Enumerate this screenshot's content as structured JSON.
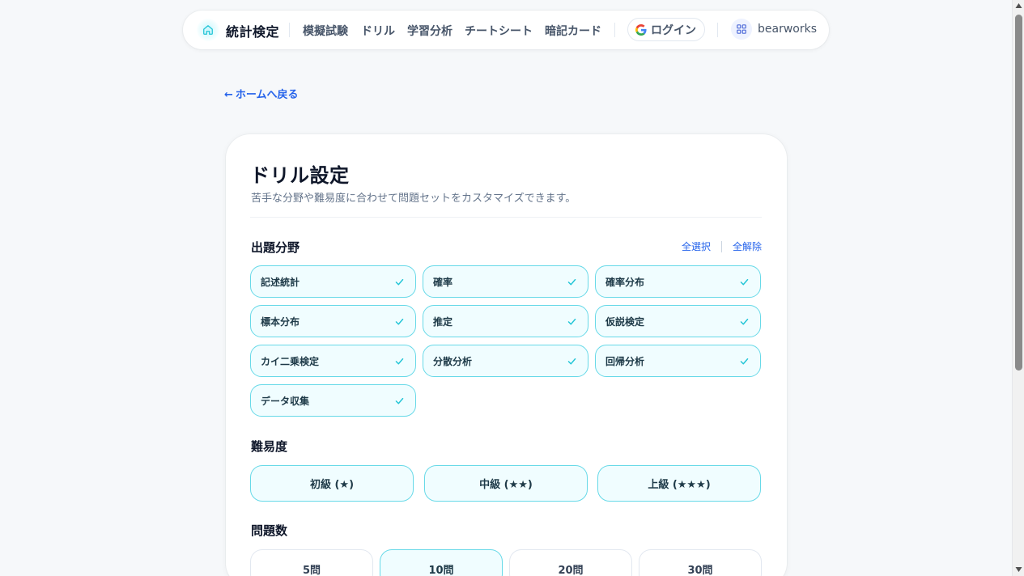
{
  "nav": {
    "brand": "統計検定",
    "links": [
      "模擬試験",
      "ドリル",
      "学習分析",
      "チートシート",
      "暗記カード"
    ],
    "login_label": "ログイン",
    "account_name": "bearworks"
  },
  "back_link": "ホームへ戻る",
  "back_arrow": "←",
  "card": {
    "title": "ドリル設定",
    "subtitle": "苦手な分野や難易度に合わせて問題セットをカスタマイズできます。"
  },
  "categories": {
    "title": "出題分野",
    "select_all": "全選択",
    "clear_all": "全解除",
    "items": [
      {
        "label": "記述統計",
        "checked": true
      },
      {
        "label": "確率",
        "checked": true
      },
      {
        "label": "確率分布",
        "checked": true
      },
      {
        "label": "標本分布",
        "checked": true
      },
      {
        "label": "推定",
        "checked": true
      },
      {
        "label": "仮説検定",
        "checked": true
      },
      {
        "label": "カイ二乗検定",
        "checked": true
      },
      {
        "label": "分散分析",
        "checked": true
      },
      {
        "label": "回帰分析",
        "checked": true
      },
      {
        "label": "データ収集",
        "checked": true
      }
    ]
  },
  "difficulty": {
    "title": "難易度",
    "options": [
      "初級 (★)",
      "中級 (★★)",
      "上級 (★★★)"
    ],
    "selected": [
      "初級 (★)",
      "中級 (★★)",
      "上級 (★★★)"
    ]
  },
  "question_count": {
    "title": "問題数",
    "options": [
      "5問",
      "10問",
      "20問",
      "30問"
    ],
    "selected": "10問"
  },
  "colors": {
    "accent": "#2563eb",
    "chip_border": "#67d9e8",
    "chip_bg": "#f0fdff",
    "check": "#22c5d6"
  }
}
